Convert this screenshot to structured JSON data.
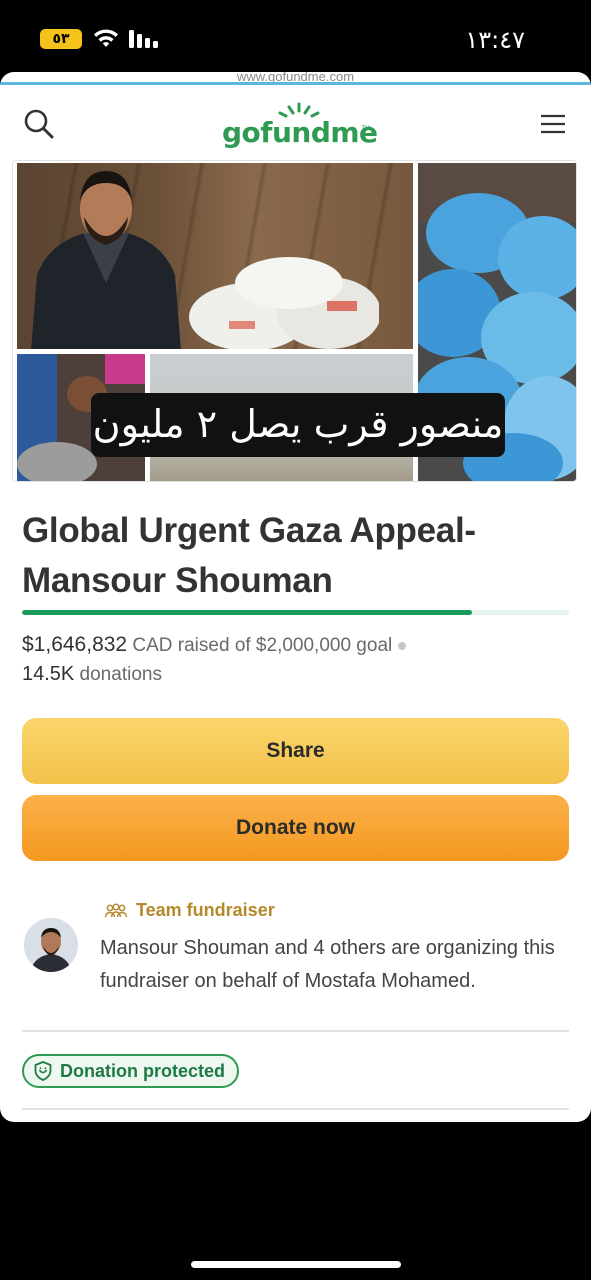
{
  "status_bar": {
    "battery_percent": "٥٣",
    "time": "١٣:٤٧"
  },
  "browser": {
    "url": "www.gofundme.com"
  },
  "header": {
    "logo_text": "gofundme",
    "logo_tm": "TM",
    "brand_color": "#2e9a52"
  },
  "hero": {
    "overlay_caption": "منصور قرب يصل ٢ مليون"
  },
  "campaign": {
    "title": "Global Urgent Gaza Appeal-Mansour Shouman",
    "raised_amount": "$1,646,832",
    "raised_suffix": "CAD raised of $2,000,000 goal",
    "donation_count": "14.5K",
    "donation_label": "donations",
    "progress_fraction": 0.823
  },
  "actions": {
    "share_label": "Share",
    "donate_label": "Donate now"
  },
  "organizer": {
    "team_label": "Team fundraiser",
    "description": "Mansour Shouman and 4 others are organizing this fundraiser on behalf of Mostafa Mohamed."
  },
  "badges": {
    "protected_label": "Donation protected"
  }
}
